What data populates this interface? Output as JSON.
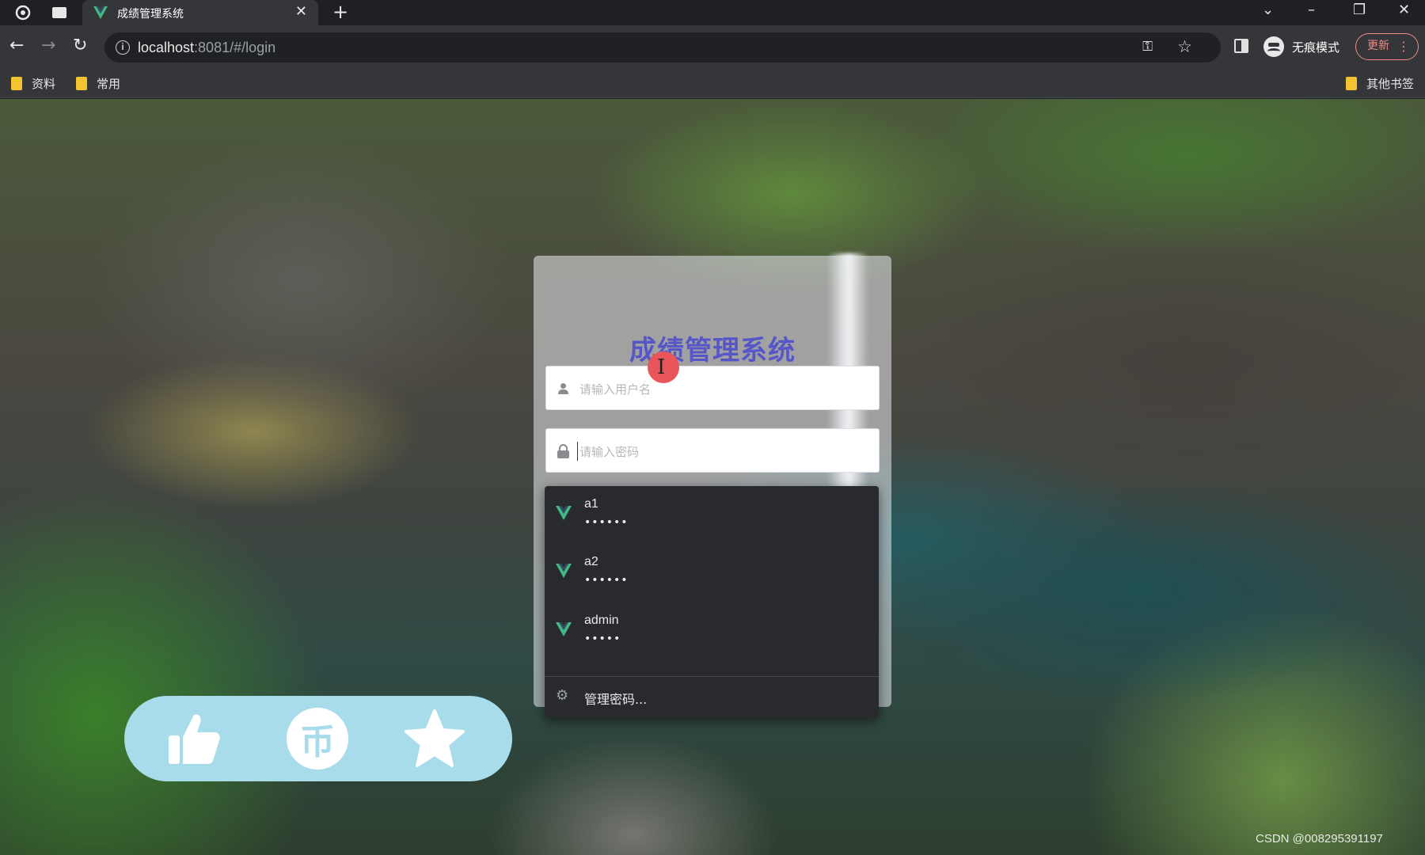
{
  "browser": {
    "tab_title": "成绩管理系统",
    "new_tab_glyph": "+",
    "url_host": "localhost",
    "url_rest": ":8081/#/login",
    "incognito_label": "无痕模式",
    "update_label": "更新",
    "bookmarks": [
      "资料",
      "常用"
    ],
    "other_bookmarks": "其他书签"
  },
  "login": {
    "title": "成绩管理系统",
    "username_placeholder": "请输入用户名",
    "password_placeholder": "请输入密码"
  },
  "autofill": {
    "items": [
      {
        "username": "a1",
        "password_mask": "••••••"
      },
      {
        "username": "a2",
        "password_mask": "••••••"
      },
      {
        "username": "admin",
        "password_mask": "•••••"
      }
    ],
    "manage_label": "管理密码..."
  },
  "action_bar": {
    "coin_glyph": "币",
    "color": "#a9dcea"
  },
  "watermark": "CSDN @008295391197",
  "colors": {
    "title": "#5656c8",
    "vue_green": "#41b883",
    "update_red": "#f28b82"
  }
}
